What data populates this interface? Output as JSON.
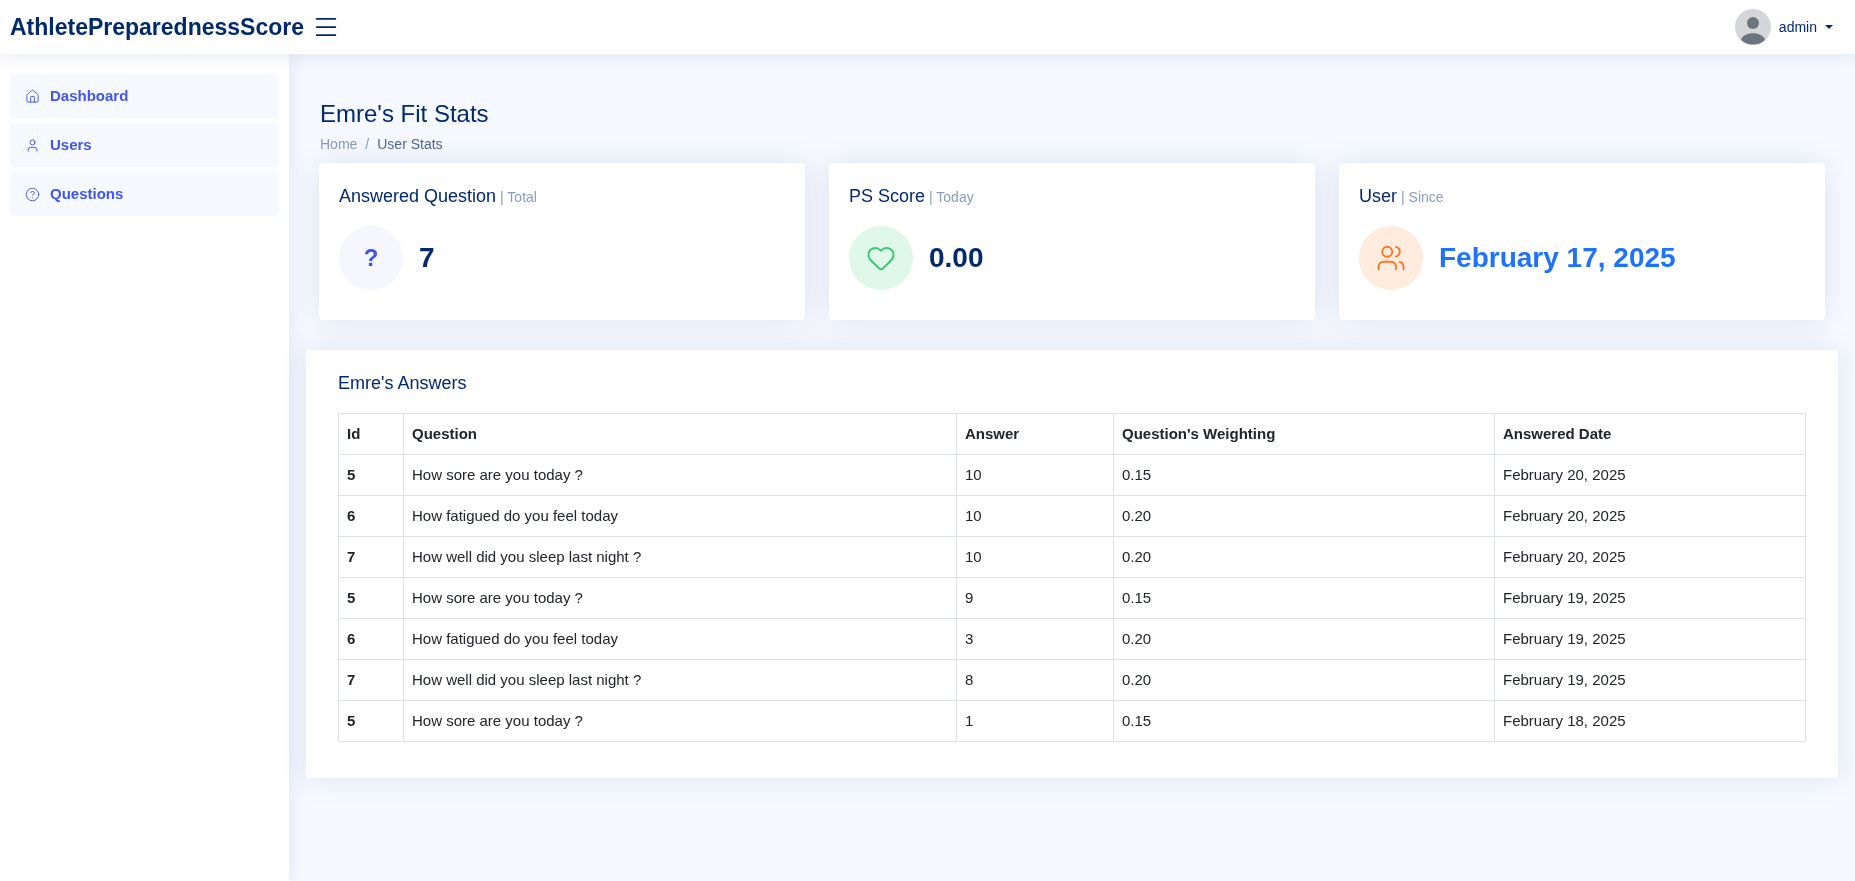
{
  "header": {
    "brand": "AthletePreparednessScore",
    "user": "admin"
  },
  "sidebar": {
    "items": [
      {
        "label": "Dashboard",
        "kind": "home"
      },
      {
        "label": "Users",
        "kind": "user"
      },
      {
        "label": "Questions",
        "kind": "question"
      }
    ]
  },
  "page": {
    "title": "Emre's Fit Stats",
    "breadcrumbs": [
      "Home",
      "User Stats"
    ],
    "breadcrumb_separator": "/"
  },
  "cards": [
    {
      "title": "Answered Question",
      "subtitle": "| Total",
      "value": "7",
      "kind": "question",
      "icon_text": "?"
    },
    {
      "title": "PS Score",
      "subtitle": "| Today",
      "value": "0.00",
      "kind": "score"
    },
    {
      "title": "User",
      "subtitle": "| Since",
      "value": "February 17, 2025",
      "kind": "since"
    }
  ],
  "answers": {
    "title": "Emre's Answers",
    "columns": [
      "Id",
      "Question",
      "Answer",
      "Question's Weighting",
      "Answered Date"
    ],
    "rows": [
      [
        "5",
        "How sore are you today ?",
        "10",
        "0.15",
        "February 20, 2025"
      ],
      [
        "6",
        "How fatigued do you feel today",
        "10",
        "0.20",
        "February 20, 2025"
      ],
      [
        "7",
        "How well did you sleep last night ?",
        "10",
        "0.20",
        "February 20, 2025"
      ],
      [
        "5",
        "How sore are you today ?",
        "9",
        "0.15",
        "February 19, 2025"
      ],
      [
        "6",
        "How fatigued do you feel today",
        "3",
        "0.20",
        "February 19, 2025"
      ],
      [
        "7",
        "How well did you sleep last night ?",
        "8",
        "0.20",
        "February 19, 2025"
      ],
      [
        "5",
        "How sore are you today ?",
        "1",
        "0.15",
        "February 18, 2025"
      ]
    ]
  }
}
